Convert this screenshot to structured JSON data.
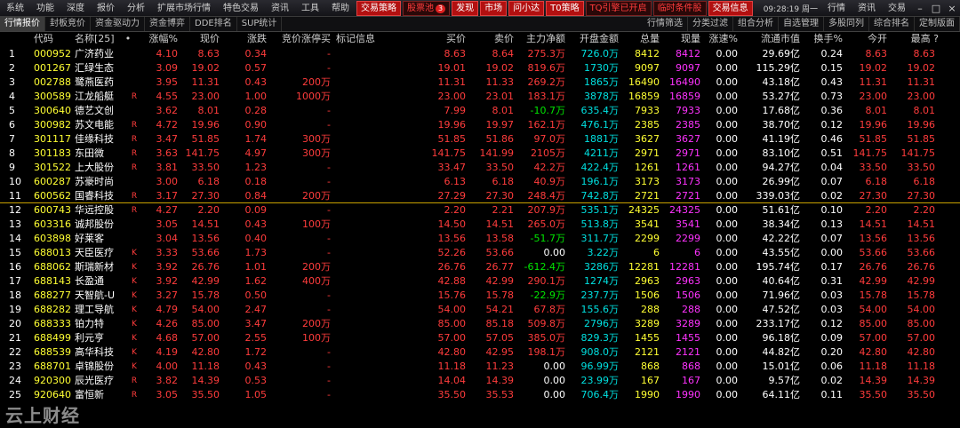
{
  "menu": {
    "items": [
      "系统",
      "功能",
      "深度",
      "报价",
      "分析",
      "扩展市场行情",
      "特色交易",
      "资讯",
      "工具",
      "帮助"
    ],
    "highlights": [
      "交易策略",
      "股票池",
      "发现",
      "市场",
      "问小达",
      "T0策略",
      "TQ引擎已开启",
      "临时条件股",
      "交易信息"
    ],
    "badge": "3",
    "clock": "09:28:19 周一",
    "right": [
      "行情",
      "资讯",
      "交易"
    ]
  },
  "tabs_left": [
    "行情报价",
    "封板竞价",
    "资金驱动力",
    "资金博弈",
    "DDE排名",
    "SUP统计"
  ],
  "tabs_right": [
    "行情筛选",
    "分类过滤",
    "组合分析",
    "自选管理",
    "多股同列",
    "综合排名",
    "定制版面"
  ],
  "columns": [
    "代码",
    "名称[25]",
    "•",
    "涨幅%",
    "现价",
    "涨跌",
    "竞价涨停买",
    "标记信息",
    "买价",
    "卖价",
    "主力净额",
    "开盘金额",
    "总量",
    "现量",
    "涨速%",
    "流通市值",
    "换手%",
    "今开",
    "最高 ?"
  ],
  "rows": [
    {
      "idx": "1",
      "code": "000952",
      "name": "广济药业",
      "flag": "",
      "pct": "4.10",
      "price": "8.63",
      "chg": "0.34",
      "bid": "-",
      "buy": "8.63",
      "sell": "8.64",
      "net": "275.3万",
      "open_amt": "726.0万",
      "vol": "8412",
      "cur": "8412",
      "speed": "0.00",
      "mcap": "29.69亿",
      "turn": "0.24",
      "open": "8.63",
      "high": "8.63"
    },
    {
      "idx": "2",
      "code": "001267",
      "name": "汇绿生态",
      "flag": "",
      "pct": "3.09",
      "price": "19.02",
      "chg": "0.57",
      "bid": "-",
      "buy": "19.01",
      "sell": "19.02",
      "net": "819.6万",
      "open_amt": "1730万",
      "vol": "9097",
      "cur": "9097",
      "speed": "0.00",
      "mcap": "115.29亿",
      "turn": "0.15",
      "open": "19.02",
      "high": "19.02"
    },
    {
      "idx": "3",
      "code": "002788",
      "name": "鹭燕医药",
      "flag": "",
      "pct": "3.95",
      "price": "11.31",
      "chg": "0.43",
      "bid": "200万",
      "buy": "11.31",
      "sell": "11.33",
      "net": "269.2万",
      "open_amt": "1865万",
      "vol": "16490",
      "cur": "16490",
      "speed": "0.00",
      "mcap": "43.18亿",
      "turn": "0.43",
      "open": "11.31",
      "high": "11.31"
    },
    {
      "idx": "4",
      "code": "300589",
      "name": "江龙船艇",
      "flag": "R",
      "pct": "4.55",
      "price": "23.00",
      "chg": "1.00",
      "bid": "1000万",
      "buy": "23.00",
      "sell": "23.01",
      "net": "183.1万",
      "open_amt": "3878万",
      "vol": "16859",
      "cur": "16859",
      "speed": "0.00",
      "mcap": "53.27亿",
      "turn": "0.73",
      "open": "23.00",
      "high": "23.00"
    },
    {
      "idx": "5",
      "code": "300640",
      "name": "德艺文创",
      "flag": "",
      "pct": "3.62",
      "price": "8.01",
      "chg": "0.28",
      "bid": "-",
      "buy": "7.99",
      "sell": "8.01",
      "net": "-10.7万",
      "open_amt": "635.4万",
      "vol": "7933",
      "cur": "7933",
      "speed": "0.00",
      "mcap": "17.68亿",
      "turn": "0.36",
      "open": "8.01",
      "high": "8.01"
    },
    {
      "idx": "6",
      "code": "300982",
      "name": "苏文电能",
      "flag": "R",
      "pct": "4.72",
      "price": "19.96",
      "chg": "0.90",
      "bid": "-",
      "buy": "19.96",
      "sell": "19.97",
      "net": "162.1万",
      "open_amt": "476.1万",
      "vol": "2385",
      "cur": "2385",
      "speed": "0.00",
      "mcap": "38.70亿",
      "turn": "0.12",
      "open": "19.96",
      "high": "19.96"
    },
    {
      "idx": "7",
      "code": "301117",
      "name": "佳缘科技",
      "flag": "R",
      "pct": "3.47",
      "price": "51.85",
      "chg": "1.74",
      "bid": "300万",
      "buy": "51.85",
      "sell": "51.86",
      "net": "97.0万",
      "open_amt": "1881万",
      "vol": "3627",
      "cur": "3627",
      "speed": "0.00",
      "mcap": "41.19亿",
      "turn": "0.46",
      "open": "51.85",
      "high": "51.85"
    },
    {
      "idx": "8",
      "code": "301183",
      "name": "东田微",
      "flag": "R",
      "pct": "3.63",
      "price": "141.75",
      "chg": "4.97",
      "bid": "300万",
      "buy": "141.75",
      "sell": "141.99",
      "net": "2105万",
      "open_amt": "4211万",
      "vol": "2971",
      "cur": "2971",
      "speed": "0.00",
      "mcap": "83.10亿",
      "turn": "0.51",
      "open": "141.75",
      "high": "141.75"
    },
    {
      "idx": "9",
      "code": "301522",
      "name": "上大股份",
      "flag": "R",
      "pct": "3.81",
      "price": "33.50",
      "chg": "1.23",
      "bid": "-",
      "buy": "33.47",
      "sell": "33.50",
      "net": "42.2万",
      "open_amt": "422.4万",
      "vol": "1261",
      "cur": "1261",
      "speed": "0.00",
      "mcap": "94.27亿",
      "turn": "0.04",
      "open": "33.50",
      "high": "33.50"
    },
    {
      "idx": "10",
      "code": "600287",
      "name": "苏豪时尚",
      "flag": "",
      "pct": "3.00",
      "price": "6.18",
      "chg": "0.18",
      "bid": "-",
      "buy": "6.13",
      "sell": "6.18",
      "net": "40.9万",
      "open_amt": "196.1万",
      "vol": "3173",
      "cur": "3173",
      "speed": "0.00",
      "mcap": "26.99亿",
      "turn": "0.07",
      "open": "6.18",
      "high": "6.18"
    },
    {
      "idx": "11",
      "code": "600562",
      "name": "国睿科技",
      "flag": "R",
      "pct": "3.17",
      "price": "27.30",
      "chg": "0.84",
      "bid": "200万",
      "buy": "27.29",
      "sell": "27.30",
      "net": "248.4万",
      "open_amt": "742.8万",
      "vol": "2721",
      "cur": "2721",
      "speed": "0.00",
      "mcap": "339.03亿",
      "turn": "0.02",
      "open": "27.30",
      "high": "27.30"
    },
    {
      "idx": "12",
      "code": "600743",
      "name": "华远控股",
      "flag": "R",
      "pct": "4.27",
      "price": "2.20",
      "chg": "0.09",
      "bid": "-",
      "buy": "2.20",
      "sell": "2.21",
      "net": "207.9万",
      "open_amt": "535.1万",
      "vol": "24325",
      "cur": "24325",
      "speed": "0.00",
      "mcap": "51.61亿",
      "turn": "0.10",
      "open": "2.20",
      "high": "2.20"
    },
    {
      "idx": "13",
      "code": "603316",
      "name": "诚邦股份",
      "flag": "",
      "pct": "3.05",
      "price": "14.51",
      "chg": "0.43",
      "bid": "100万",
      "buy": "14.50",
      "sell": "14.51",
      "net": "265.0万",
      "open_amt": "513.8万",
      "vol": "3541",
      "cur": "3541",
      "speed": "0.00",
      "mcap": "38.34亿",
      "turn": "0.13",
      "open": "14.51",
      "high": "14.51"
    },
    {
      "idx": "14",
      "code": "603898",
      "name": "好莱客",
      "flag": "",
      "pct": "3.04",
      "price": "13.56",
      "chg": "0.40",
      "bid": "-",
      "buy": "13.56",
      "sell": "13.58",
      "net": "-51.7万",
      "open_amt": "311.7万",
      "vol": "2299",
      "cur": "2299",
      "speed": "0.00",
      "mcap": "42.22亿",
      "turn": "0.07",
      "open": "13.56",
      "high": "13.56"
    },
    {
      "idx": "15",
      "code": "688013",
      "name": "天臣医疗",
      "flag": "K",
      "pct": "3.33",
      "price": "53.66",
      "chg": "1.73",
      "bid": "-",
      "buy": "52.26",
      "sell": "53.66",
      "net": "0.00",
      "open_amt": "3.22万",
      "vol": "6",
      "cur": "6",
      "speed": "0.00",
      "mcap": "43.55亿",
      "turn": "0.00",
      "open": "53.66",
      "high": "53.66"
    },
    {
      "idx": "16",
      "code": "688062",
      "name": "斯瑞新材",
      "flag": "K",
      "pct": "3.92",
      "price": "26.76",
      "chg": "1.01",
      "bid": "200万",
      "buy": "26.76",
      "sell": "26.77",
      "net": "-612.4万",
      "open_amt": "3286万",
      "vol": "12281",
      "cur": "12281",
      "speed": "0.00",
      "mcap": "195.74亿",
      "turn": "0.17",
      "open": "26.76",
      "high": "26.76"
    },
    {
      "idx": "17",
      "code": "688143",
      "name": "长盈通",
      "flag": "K",
      "pct": "3.92",
      "price": "42.99",
      "chg": "1.62",
      "bid": "400万",
      "buy": "42.88",
      "sell": "42.99",
      "net": "290.1万",
      "open_amt": "1274万",
      "vol": "2963",
      "cur": "2963",
      "speed": "0.00",
      "mcap": "40.64亿",
      "turn": "0.31",
      "open": "42.99",
      "high": "42.99"
    },
    {
      "idx": "18",
      "code": "688277",
      "name": "天智航-U",
      "flag": "K",
      "pct": "3.27",
      "price": "15.78",
      "chg": "0.50",
      "bid": "-",
      "buy": "15.76",
      "sell": "15.78",
      "net": "-22.9万",
      "open_amt": "237.7万",
      "vol": "1506",
      "cur": "1506",
      "speed": "0.00",
      "mcap": "71.96亿",
      "turn": "0.03",
      "open": "15.78",
      "high": "15.78"
    },
    {
      "idx": "19",
      "code": "688282",
      "name": "理工导航",
      "flag": "K",
      "pct": "4.79",
      "price": "54.00",
      "chg": "2.47",
      "bid": "-",
      "buy": "54.00",
      "sell": "54.21",
      "net": "67.8万",
      "open_amt": "155.6万",
      "vol": "288",
      "cur": "288",
      "speed": "0.00",
      "mcap": "47.52亿",
      "turn": "0.03",
      "open": "54.00",
      "high": "54.00"
    },
    {
      "idx": "20",
      "code": "688333",
      "name": "铂力特",
      "flag": "K",
      "pct": "4.26",
      "price": "85.00",
      "chg": "3.47",
      "bid": "200万",
      "buy": "85.00",
      "sell": "85.18",
      "net": "509.8万",
      "open_amt": "2796万",
      "vol": "3289",
      "cur": "3289",
      "speed": "0.00",
      "mcap": "233.17亿",
      "turn": "0.12",
      "open": "85.00",
      "high": "85.00"
    },
    {
      "idx": "21",
      "code": "688499",
      "name": "利元亨",
      "flag": "K",
      "pct": "4.68",
      "price": "57.00",
      "chg": "2.55",
      "bid": "100万",
      "buy": "57.00",
      "sell": "57.05",
      "net": "385.0万",
      "open_amt": "829.3万",
      "vol": "1455",
      "cur": "1455",
      "speed": "0.00",
      "mcap": "96.18亿",
      "turn": "0.09",
      "open": "57.00",
      "high": "57.00"
    },
    {
      "idx": "22",
      "code": "688539",
      "name": "高华科技",
      "flag": "K",
      "pct": "4.19",
      "price": "42.80",
      "chg": "1.72",
      "bid": "-",
      "buy": "42.80",
      "sell": "42.95",
      "net": "198.1万",
      "open_amt": "908.0万",
      "vol": "2121",
      "cur": "2121",
      "speed": "0.00",
      "mcap": "44.82亿",
      "turn": "0.20",
      "open": "42.80",
      "high": "42.80"
    },
    {
      "idx": "23",
      "code": "688701",
      "name": "卓锦股份",
      "flag": "K",
      "pct": "4.00",
      "price": "11.18",
      "chg": "0.43",
      "bid": "-",
      "buy": "11.18",
      "sell": "11.23",
      "net": "0.00",
      "open_amt": "96.99万",
      "vol": "868",
      "cur": "868",
      "speed": "0.00",
      "mcap": "15.01亿",
      "turn": "0.06",
      "open": "11.18",
      "high": "11.18"
    },
    {
      "idx": "24",
      "code": "920300",
      "name": "辰光医疗",
      "flag": "R",
      "pct": "3.82",
      "price": "14.39",
      "chg": "0.53",
      "bid": "-",
      "buy": "14.04",
      "sell": "14.39",
      "net": "0.00",
      "open_amt": "23.99万",
      "vol": "167",
      "cur": "167",
      "speed": "0.00",
      "mcap": "9.57亿",
      "turn": "0.02",
      "open": "14.39",
      "high": "14.39"
    },
    {
      "idx": "25",
      "code": "920640",
      "name": "富恒新",
      "flag": "R",
      "pct": "3.05",
      "price": "35.50",
      "chg": "1.05",
      "bid": "-",
      "buy": "35.50",
      "sell": "35.53",
      "net": "0.00",
      "open_amt": "706.4万",
      "vol": "1990",
      "cur": "1990",
      "speed": "0.00",
      "mcap": "64.11亿",
      "turn": "0.11",
      "open": "35.50",
      "high": "35.50"
    }
  ],
  "watermark": "云上财经",
  "colors": {
    "up": "#ff3c3c",
    "down": "#00e600",
    "code": "#ffff33",
    "volume": "#ffff33",
    "current_volume": "#ff33ff",
    "open_amount": "#00e0e0",
    "selected_line": "#c8a000"
  }
}
